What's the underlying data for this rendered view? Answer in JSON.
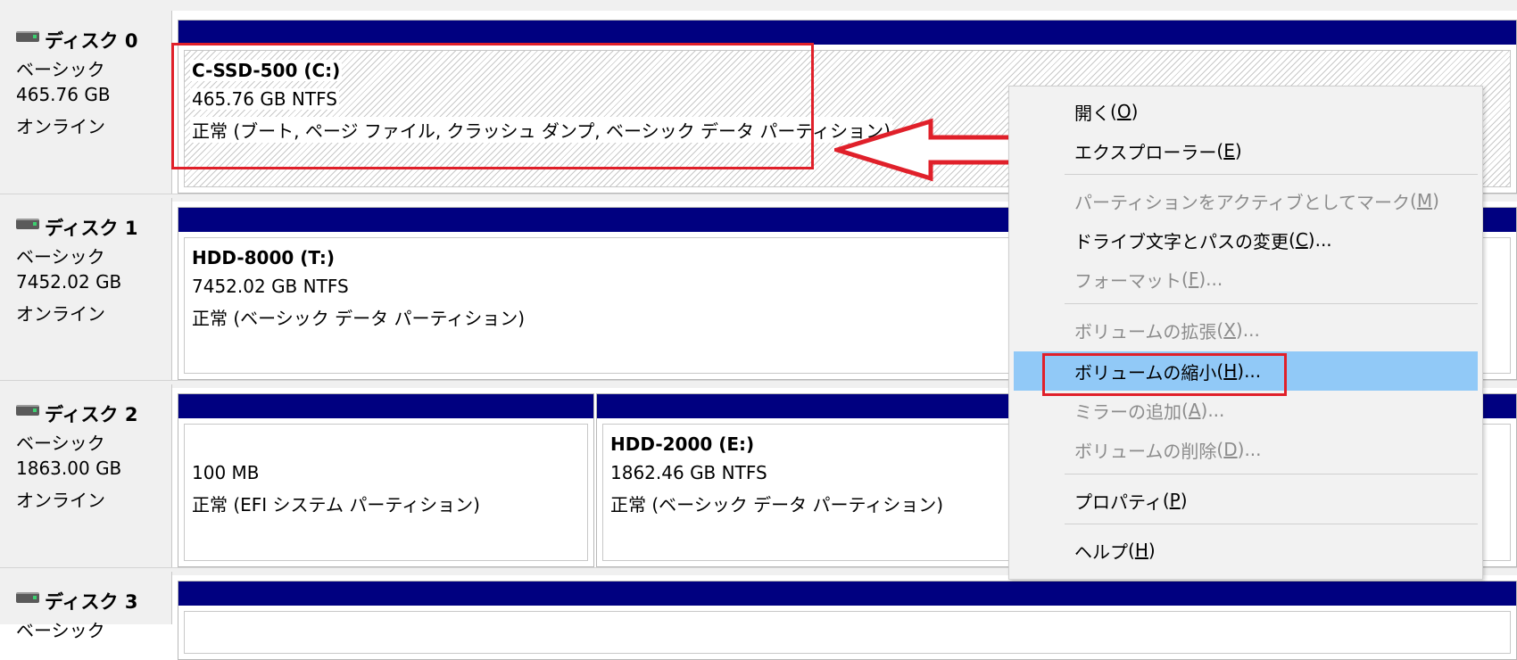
{
  "disks": [
    {
      "title": "ディスク 0",
      "type": "ベーシック",
      "size": "465.76 GB",
      "status": "オンライン",
      "partitions": [
        {
          "name": "C-SSD-500  (C:)",
          "size_fs": "465.76 GB NTFS",
          "state": "正常 (ブート, ページ ファイル, クラッシュ ダンプ, ベーシック データ パーティション)"
        }
      ]
    },
    {
      "title": "ディスク 1",
      "type": "ベーシック",
      "size": "7452.02 GB",
      "status": "オンライン",
      "partitions": [
        {
          "name": "HDD-8000  (T:)",
          "size_fs": "7452.02 GB NTFS",
          "state": "正常 (ベーシック データ パーティション)"
        }
      ]
    },
    {
      "title": "ディスク 2",
      "type": "ベーシック",
      "size": "1863.00 GB",
      "status": "オンライン",
      "partitions": [
        {
          "name": "",
          "size_fs": "100 MB",
          "state": "正常 (EFI システム パーティション)"
        },
        {
          "name": "HDD-2000  (E:)",
          "size_fs": "1862.46 GB NTFS",
          "state": "正常 (ベーシック データ パーティション)"
        }
      ]
    },
    {
      "title": "ディスク 3",
      "type": "ベーシック"
    }
  ],
  "context_menu": {
    "items": [
      {
        "label": "開く",
        "key": "O",
        "suffix": "",
        "enabled": true
      },
      {
        "label": "エクスプローラー",
        "key": "E",
        "suffix": "",
        "enabled": true
      },
      {
        "label": "パーティションをアクティブとしてマーク",
        "key": "M",
        "suffix": "",
        "enabled": false
      },
      {
        "label": "ドライブ文字とパスの変更",
        "key": "C",
        "suffix": "...",
        "enabled": true
      },
      {
        "label": "フォーマット",
        "key": "F",
        "suffix": "...",
        "enabled": false
      },
      {
        "label": "ボリュームの拡張",
        "key": "X",
        "suffix": "...",
        "enabled": false
      },
      {
        "label": "ボリュームの縮小",
        "key": "H",
        "suffix": "...",
        "enabled": true,
        "highlighted": true
      },
      {
        "label": "ミラーの追加",
        "key": "A",
        "suffix": "...",
        "enabled": false
      },
      {
        "label": "ボリュームの削除",
        "key": "D",
        "suffix": "...",
        "enabled": false
      },
      {
        "label": "プロパティ",
        "key": "P",
        "suffix": "",
        "enabled": true
      },
      {
        "label": "ヘルプ",
        "key": "H",
        "suffix": "",
        "enabled": true
      }
    ]
  },
  "colors": {
    "partition_header": "#000080",
    "annotation_red": "#e0202a",
    "menu_highlight": "#91c9f7",
    "menu_background": "#f2f2f2",
    "disabled_text": "#8c8c8c"
  }
}
